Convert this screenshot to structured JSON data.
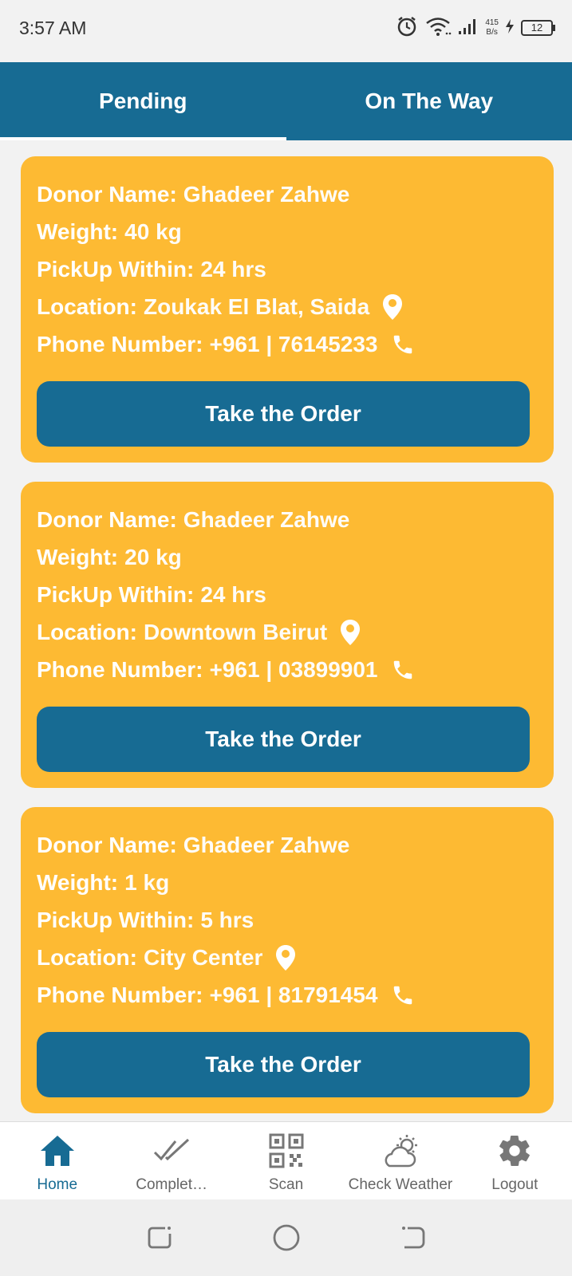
{
  "status_bar": {
    "time": "3:57 AM",
    "net_speed_value": "415",
    "net_speed_unit": "B/s",
    "battery_level": "12",
    "icons": [
      "alarm-icon",
      "wifi-icon",
      "signal-icon",
      "charging-icon",
      "battery-icon"
    ]
  },
  "tabs": [
    {
      "label": "Pending",
      "active": true
    },
    {
      "label": "On The Way",
      "active": false
    }
  ],
  "labels": {
    "donor": "Donor Name:",
    "weight": "Weight:",
    "pickup": "PickUp Within:",
    "location": "Location:",
    "phone": "Phone Number:"
  },
  "orders": [
    {
      "donor": "Ghadeer Zahwe",
      "weight": "40 kg",
      "pickup": "24  hrs",
      "location": "Zoukak El Blat, Saida",
      "phone": "+961 | 76145233",
      "button": "Take the Order"
    },
    {
      "donor": "Ghadeer Zahwe",
      "weight": "20 kg",
      "pickup": "24 hrs",
      "location": "Downtown Beirut",
      "phone": "+961 | 03899901",
      "button": "Take the Order"
    },
    {
      "donor": "Ghadeer Zahwe",
      "weight": "1 kg",
      "pickup": "5 hrs",
      "location": "City Center",
      "phone": "+961 | 81791454",
      "button": "Take the Order"
    }
  ],
  "bottom_nav": [
    {
      "label": "Home",
      "icon": "home-icon",
      "active": true
    },
    {
      "label": "Complet…",
      "icon": "double-check-icon",
      "active": false
    },
    {
      "label": "Scan",
      "icon": "qr-code-icon",
      "active": false
    },
    {
      "label": "Check Weather",
      "icon": "weather-icon",
      "active": false
    },
    {
      "label": "Logout",
      "icon": "gear-icon",
      "active": false
    }
  ],
  "system_nav": [
    "recents-icon",
    "home-circle-icon",
    "back-icon"
  ],
  "colors": {
    "primary": "#176b93",
    "card": "#fdba33",
    "text_on_card": "#ffffff",
    "background": "#f2f2f2"
  }
}
